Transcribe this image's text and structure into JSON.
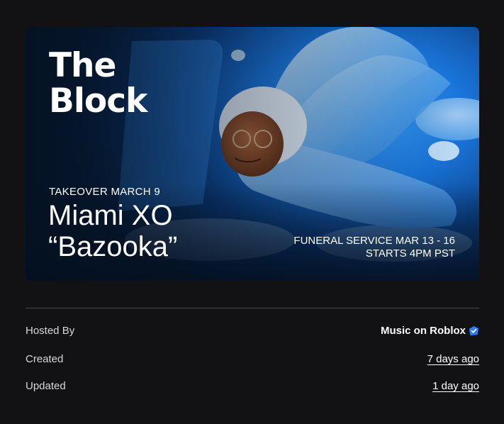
{
  "banner": {
    "title_line1": "The",
    "title_line2": "Block",
    "takeover": "TAKEOVER MARCH 9",
    "artist_line1": "Miami XO",
    "artist_line2": "“Bazooka”",
    "funeral_line1": "FUNERAL SERVICE MAR 13 - 16",
    "funeral_line2": "STARTS 4PM PST"
  },
  "details": {
    "hosted_by_label": "Hosted By",
    "hosted_by_value": "Music on Roblox",
    "created_label": "Created",
    "created_value": "7 days ago",
    "updated_label": "Updated",
    "updated_value": "1 day ago"
  },
  "colors": {
    "background": "#121215",
    "verified_badge": "#2f7bff"
  }
}
